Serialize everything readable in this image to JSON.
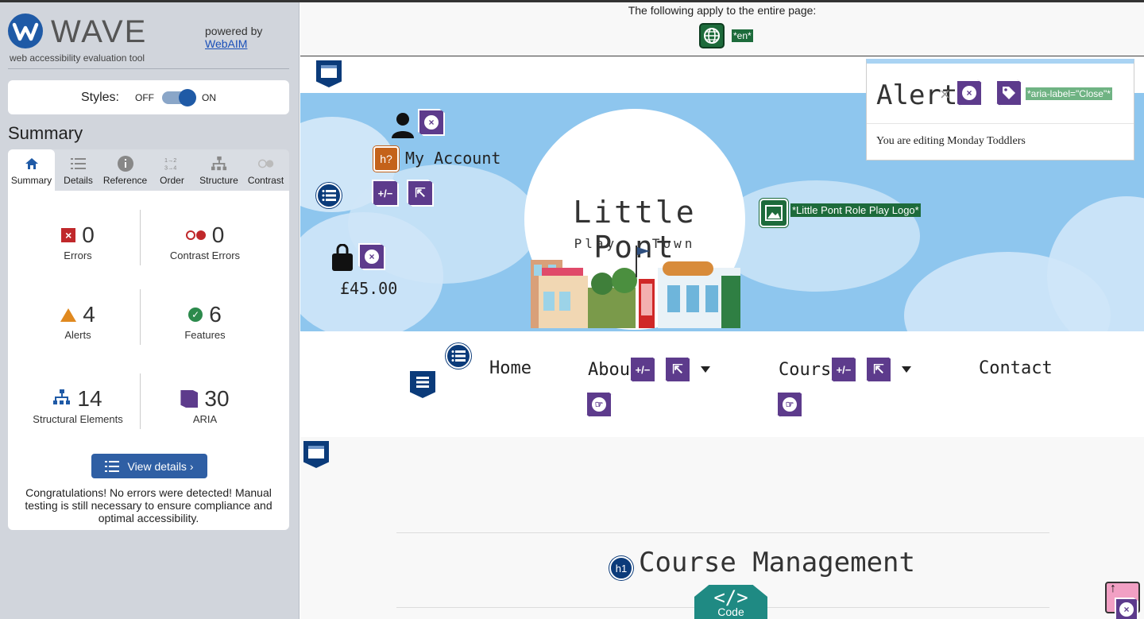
{
  "wave": {
    "brand": "WAVE",
    "tagline": "web accessibility evaluation tool",
    "powered_by": "powered by",
    "powered_link": "WebAIM",
    "styles_label": "Styles:",
    "styles_off": "OFF",
    "styles_on": "ON",
    "summary_title": "Summary",
    "tabs": [
      {
        "label": "Summary",
        "icon": "home-icon"
      },
      {
        "label": "Details",
        "icon": "list-icon"
      },
      {
        "label": "Reference",
        "icon": "info-icon"
      },
      {
        "label": "Order",
        "icon": "order-icon"
      },
      {
        "label": "Structure",
        "icon": "structure-icon"
      },
      {
        "label": "Contrast",
        "icon": "contrast-icon"
      }
    ],
    "stats": {
      "errors": {
        "value": "0",
        "label": "Errors"
      },
      "contrast_errors": {
        "value": "0",
        "label": "Contrast Errors"
      },
      "alerts": {
        "value": "4",
        "label": "Alerts"
      },
      "features": {
        "value": "6",
        "label": "Features"
      },
      "structural": {
        "value": "14",
        "label": "Structural Elements"
      },
      "aria": {
        "value": "30",
        "label": "ARIA"
      }
    },
    "view_details": "View details ›",
    "congrats": "Congratulations! No errors were detected! Manual testing is still necessary to ensure compliance and optimal accessibility."
  },
  "page": {
    "applies_text": "The following apply to the entire page:",
    "lang_tag": "*en*",
    "account_label": "My Account",
    "price": "£45.00",
    "logo_title": "Little Pont",
    "logo_sub": "Play Town",
    "logo_alt": "*Little Pont Role Play Logo*",
    "nav": {
      "home": "Home",
      "about": "About",
      "courses": "Courses",
      "contact": "Contact"
    },
    "course_title": "Course Management",
    "h1_badge": "h1",
    "h_badge": "h?",
    "code_label": "Code",
    "alert_box": {
      "title": "Alert!",
      "close": "×",
      "aria_label": "*aria-label=\"Close\"*",
      "message": "You are editing Monday Toddlers"
    }
  },
  "colors": {
    "wave_blue": "#1f5aa6",
    "error_red": "#c0282b",
    "alert_orange": "#e0891f",
    "feature_green": "#2c8a4c",
    "aria_purple": "#5d3b8c",
    "structure_navy": "#0b3b7a",
    "hero_sky": "#8ec6ee"
  }
}
